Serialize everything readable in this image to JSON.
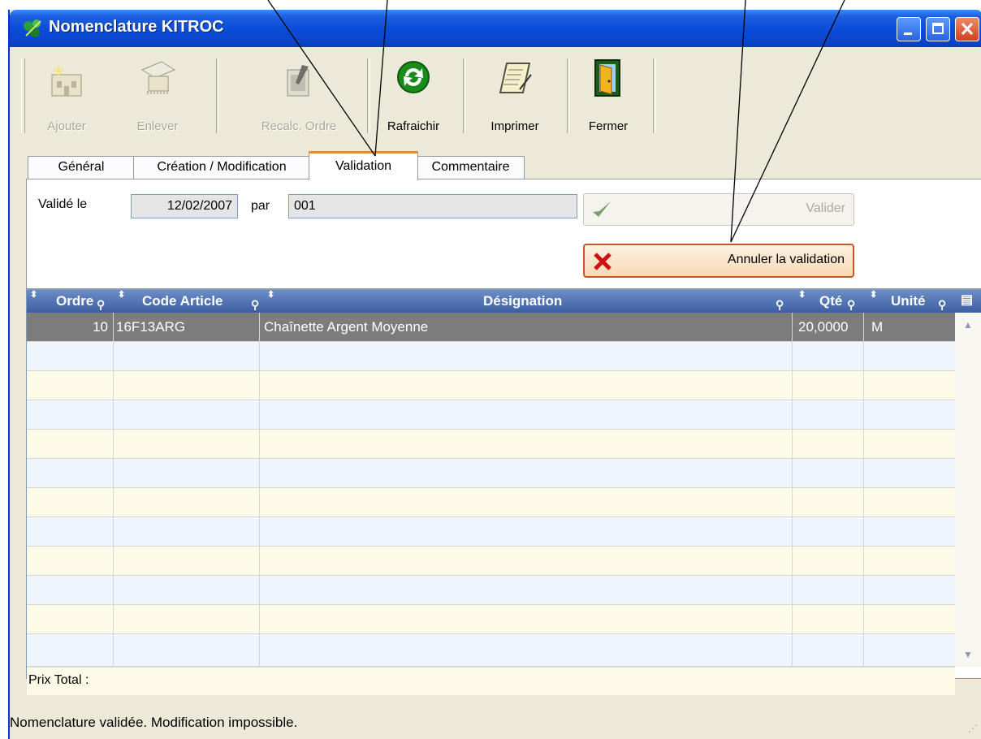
{
  "window": {
    "title": "Nomenclature KITROC"
  },
  "toolbar": {
    "buttons": [
      {
        "label": "Ajouter",
        "enabled": false,
        "icon": "add-building-icon"
      },
      {
        "label": "Enlever",
        "enabled": false,
        "icon": "remove-building-icon"
      },
      {
        "label": "Recalc. Ordre",
        "enabled": false,
        "icon": "recalc-document-icon"
      },
      {
        "label": "Rafraichir",
        "enabled": true,
        "icon": "refresh-icon"
      },
      {
        "label": "Imprimer",
        "enabled": true,
        "icon": "print-scroll-icon"
      },
      {
        "label": "Fermer",
        "enabled": true,
        "icon": "exit-door-icon"
      }
    ]
  },
  "tabs": [
    {
      "label": "Général"
    },
    {
      "label": "Création / Modification"
    },
    {
      "label": "Validation",
      "active": true
    },
    {
      "label": "Commentaire"
    }
  ],
  "validation": {
    "date_label": "Validé le",
    "date_value": "12/02/2007",
    "by_label": "par",
    "by_value": "001",
    "valider_label": "Valider",
    "annuler_label": "Annuler la validation"
  },
  "grid": {
    "columns": [
      "Ordre",
      "Code Article",
      "Désignation",
      "Qté",
      "Unité"
    ],
    "rows": [
      {
        "ordre": "10",
        "code": "16F13ARG",
        "designation": "Chaînette Argent Moyenne",
        "qte": "20,0000",
        "unite": "M"
      }
    ],
    "total_label": "Prix Total :"
  },
  "status": {
    "text": "Nomenclature validée. Modification impossible."
  },
  "colors": {
    "titlebar": "#0a4bd8",
    "selected_row": "#7c7c7c",
    "header": "#4a6cb0",
    "accent_tab": "#e68b2c"
  }
}
